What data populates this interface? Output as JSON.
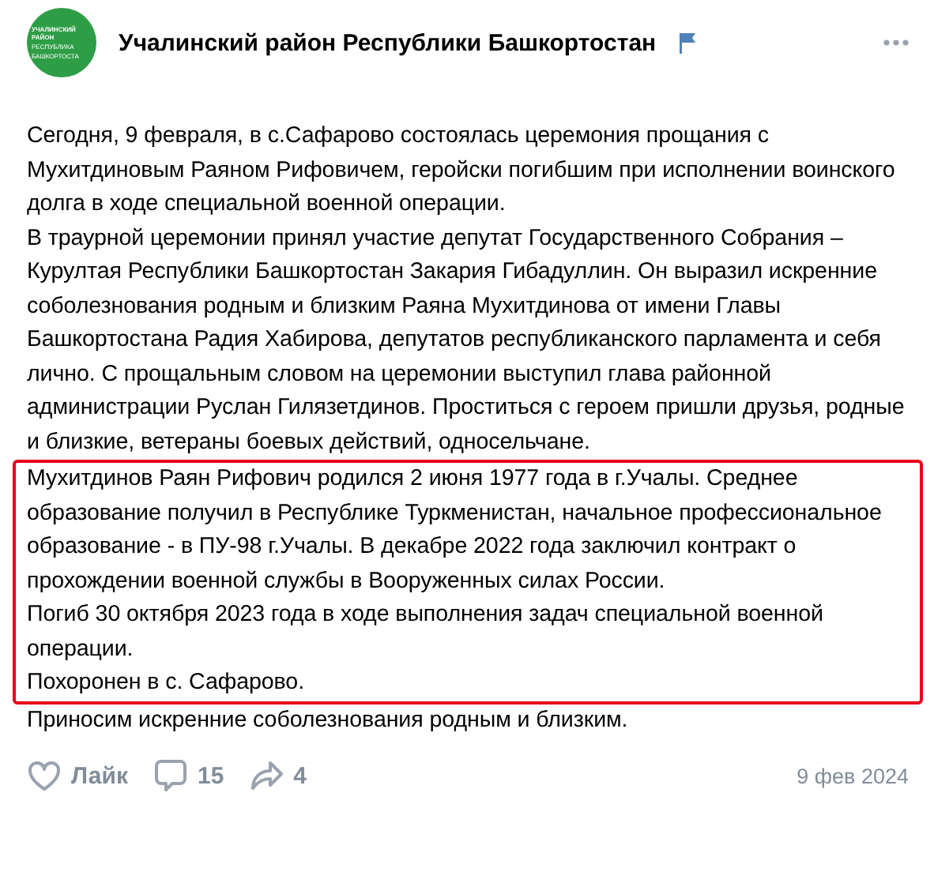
{
  "header": {
    "logo_lines": [
      "УЧАЛИНСКИЙ",
      "РАЙОН",
      "РЕСПУБЛИКА",
      "БАШКОРТОСТА"
    ],
    "title": "Учалинский район Республики Башкортостан"
  },
  "paragraphs": [
    "Сегодня, 9 февраля, в с.Сафарово состоялась церемония прощания с Мухитдиновым Раяном Рифовичем, геройски погибшим при исполнении воинского долга в ходе специальной военной операции.",
    "В траурной церемонии принял участие депутат Государственного Собрания – Курултая Республики Башкортостан Закария Гибадуллин. Он выразил искренние соболезнования родным и близким Раяна Мухитдинова от имени Главы Башкортостана Радия Хабирова, депутатов республиканского парламента и себя лично. С прощальным словом на церемонии выступил глава районной администрации Руслан Гилязетдинов. Проститься с героем пришли друзья, родные и близкие, ветераны боевых действий, односельчане."
  ],
  "highlighted_block": [
    "Мухитдинов Раян Рифович родился 2 июня 1977 года в г.Учалы. Среднее образование получил в Республике Туркменистан, начальное профессиональное образование - в ПУ-98 г.Учалы. В декабре 2022 года заключил контракт о прохождении военной службы в Вооруженных силах России.",
    "Погиб 30 октября 2023 года в ходе выполнения задач специальной военной операции.",
    "Похоронен в с. Сафарово."
  ],
  "closing_paragraphs": [
    "Приносим искренние соболезнования родным и близким."
  ],
  "footer": {
    "like": "Лайк",
    "comments": "15",
    "shares": "4",
    "date": "9 фев 2024"
  }
}
